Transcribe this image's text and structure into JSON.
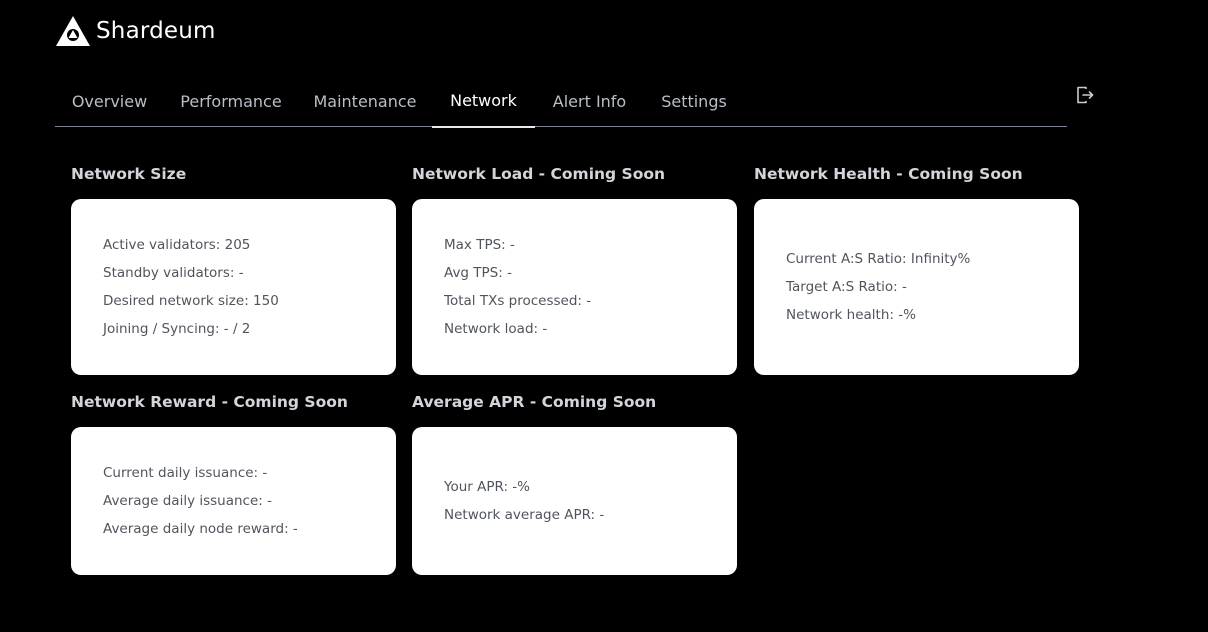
{
  "brand": {
    "name": "Shardeum",
    "logo_icon": "shardeum-logo-icon"
  },
  "tabs": [
    {
      "label": "Overview",
      "active": false
    },
    {
      "label": "Performance",
      "active": false
    },
    {
      "label": "Maintenance",
      "active": false
    },
    {
      "label": "Network",
      "active": true
    },
    {
      "label": "Alert Info",
      "active": false
    },
    {
      "label": "Settings",
      "active": false
    }
  ],
  "logout": {
    "icon": "logout-icon"
  },
  "sections": {
    "network_size": {
      "title": "Network Size",
      "rows": [
        "Active validators: 205",
        "Standby validators: -",
        "Desired network size: 150",
        "Joining / Syncing: - / 2"
      ]
    },
    "network_load": {
      "title": "Network Load - Coming Soon",
      "rows": [
        "Max TPS: -",
        "Avg TPS: -",
        "Total TXs processed: -",
        "Network load: -"
      ]
    },
    "network_health": {
      "title": "Network Health - Coming Soon",
      "rows": [
        "Current A:S Ratio: Infinity%",
        "Target A:S Ratio: -",
        "Network health: -%"
      ]
    },
    "network_reward": {
      "title": "Network Reward - Coming Soon",
      "rows": [
        "Current daily issuance: -",
        "Average daily issuance: -",
        "Average daily node reward: -"
      ]
    },
    "average_apr": {
      "title": "Average APR - Coming Soon",
      "rows": [
        "Your APR: -%",
        "Network average APR: -"
      ]
    }
  },
  "colors": {
    "background": "#000000",
    "card": "#ffffff",
    "tab_text": "#b9bec7",
    "tab_active": "#ffffff",
    "card_text": "#50555d"
  }
}
